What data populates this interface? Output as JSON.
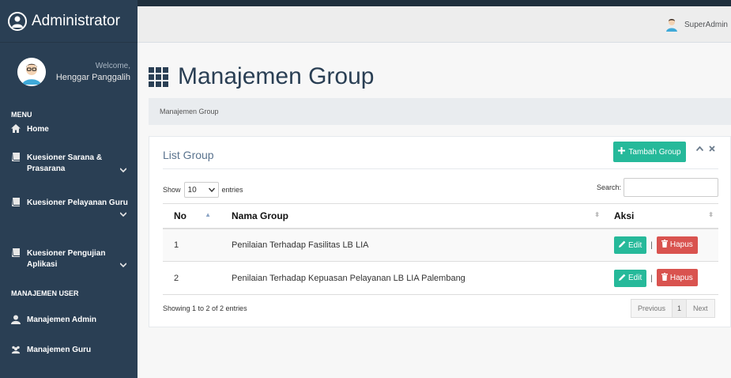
{
  "sidebar": {
    "brand": "Administrator",
    "welcome": "Welcome,",
    "username": "Henggar Panggalih",
    "menu_heading": "MENU",
    "items": [
      {
        "label": "Home"
      },
      {
        "label": "Kuesioner Sarana & Prasarana"
      },
      {
        "label": "Kuesioner Pelayanan Guru"
      },
      {
        "label": "Kuesioner Pengujian Aplikasi"
      }
    ],
    "user_heading": "MANAJEMEN USER",
    "user_items": [
      {
        "label": "Manajemen Admin"
      },
      {
        "label": "Manajemen Guru"
      }
    ]
  },
  "topbar": {
    "user": "SuperAdmin"
  },
  "page": {
    "title": "Manajemen Group",
    "breadcrumb": "Manajemen Group"
  },
  "panel": {
    "title": "List Group",
    "add_button": "Tambah Group",
    "show_label": "Show",
    "entries_value": "10",
    "entries_label": "entries",
    "search_label": "Search:",
    "columns": [
      "No",
      "Nama Group",
      "Aksi"
    ],
    "rows": [
      {
        "no": "1",
        "name": "Penilaian Terhadap Fasilitas LB LIA",
        "edit": "Edit",
        "sep": "|",
        "hapus": "Hapus"
      },
      {
        "no": "2",
        "name": "Penilaian Terhadap Kepuasan Pelayanan LB LIA Palembang",
        "edit": "Edit",
        "sep": "|",
        "hapus": "Hapus"
      }
    ],
    "info": "Showing 1 to 2 of 2 entries",
    "pager": {
      "previous": "Previous",
      "current": "1",
      "next": "Next"
    }
  },
  "colors": {
    "sidebar": "#2a3f54",
    "success": "#26b99a",
    "danger": "#d9534f"
  },
  "icons": [
    "user-icon",
    "avatar-icon",
    "home-icon",
    "book-icon",
    "chevron-down-icon",
    "user-icon",
    "users-icon",
    "grid-icon",
    "plus-icon",
    "chevron-up-icon",
    "close-icon",
    "pencil-icon",
    "trash-icon",
    "sort-icon"
  ]
}
